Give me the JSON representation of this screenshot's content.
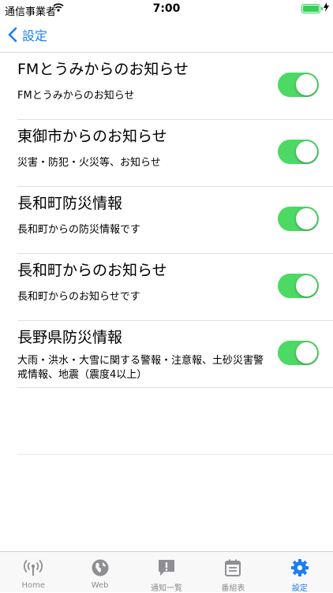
{
  "status_bar": {
    "carrier": "通信事業者",
    "time": "7:00"
  },
  "nav": {
    "back_label": "設定"
  },
  "items": [
    {
      "title": "FMとうみからのお知らせ",
      "subtitle": "FMとうみからのお知らせ",
      "enabled": true
    },
    {
      "title": "東御市からのお知らせ",
      "subtitle": "災害・防犯・火災等、お知らせ",
      "enabled": true
    },
    {
      "title": "長和町防災情報",
      "subtitle": "長和町からの防災情報です",
      "enabled": true
    },
    {
      "title": "長和町からのお知らせ",
      "subtitle": "長和町からのお知らせです",
      "enabled": true
    },
    {
      "title": "長野県防災情報",
      "subtitle": "大雨・洪水・大雪に関する警報・注意報、土砂災害警戒情報、地震（震度4以上）",
      "enabled": true
    }
  ],
  "tabs": [
    {
      "label": "Home",
      "icon": "radio-antenna-icon",
      "active": false
    },
    {
      "label": "Web",
      "icon": "globe-icon",
      "active": false
    },
    {
      "label": "通知一覧",
      "icon": "notification-alert-icon",
      "active": false
    },
    {
      "label": "番組表",
      "icon": "calendar-icon",
      "active": false
    },
    {
      "label": "設定",
      "icon": "gear-icon",
      "active": true
    }
  ],
  "colors": {
    "accent": "#1a7ef5",
    "toggle_on": "#4cd964",
    "tab_inactive": "#8e8e93"
  }
}
